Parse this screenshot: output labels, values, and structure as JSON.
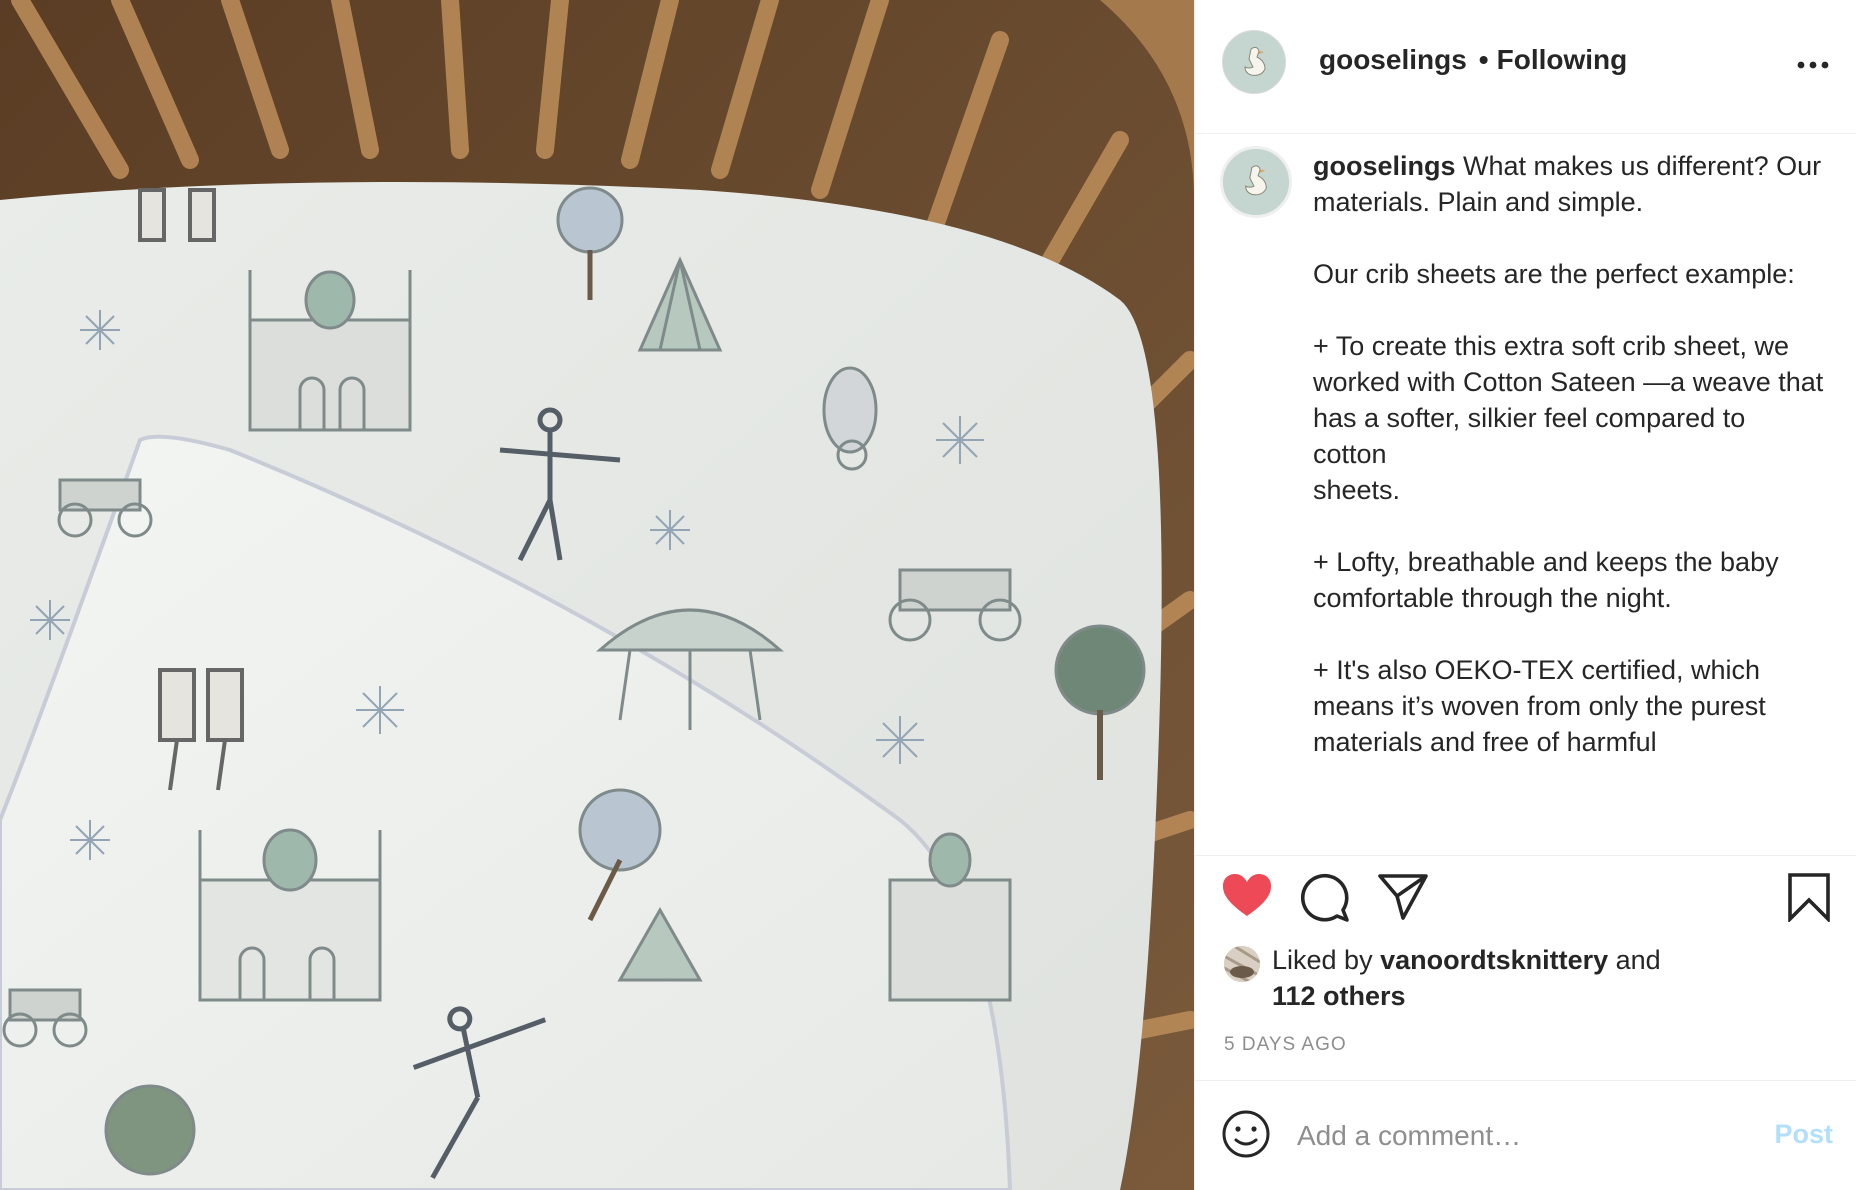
{
  "post": {
    "photo_alt": "",
    "header": {
      "username": "gooselings",
      "separator": "•",
      "follow_status": "Following",
      "more_icon": "more-options-icon"
    },
    "caption": {
      "username": "gooselings",
      "text": " What makes us different? Our materials. Plain and simple.\n\nOur crib sheets are the perfect example:\n\n+ To create this extra soft crib sheet, we worked with Cotton Sateen —a weave that has a softer, silkier feel compared to cotton\nsheets.\n\n+ Lofty, breathable and keeps the baby comfortable through the night.\n\n+ It's also OEKO-TEX certified, which means it’s woven from only the purest materials and free of harmful"
    },
    "actions": {
      "like_icon": "heart-filled-icon",
      "comment_icon": "comment-icon",
      "share_icon": "share-icon",
      "save_icon": "bookmark-icon",
      "like_color": "#ed4956"
    },
    "likes": {
      "prefix": "Liked by ",
      "liker": "vanoordtsknittery",
      "middle": " and",
      "others": "112 others"
    },
    "timestamp": "5 DAYS AGO",
    "comment": {
      "placeholder": "Add a comment…",
      "post_label": "Post",
      "emoji_icon": "smiley-icon",
      "post_color": "#b2dffc"
    }
  }
}
